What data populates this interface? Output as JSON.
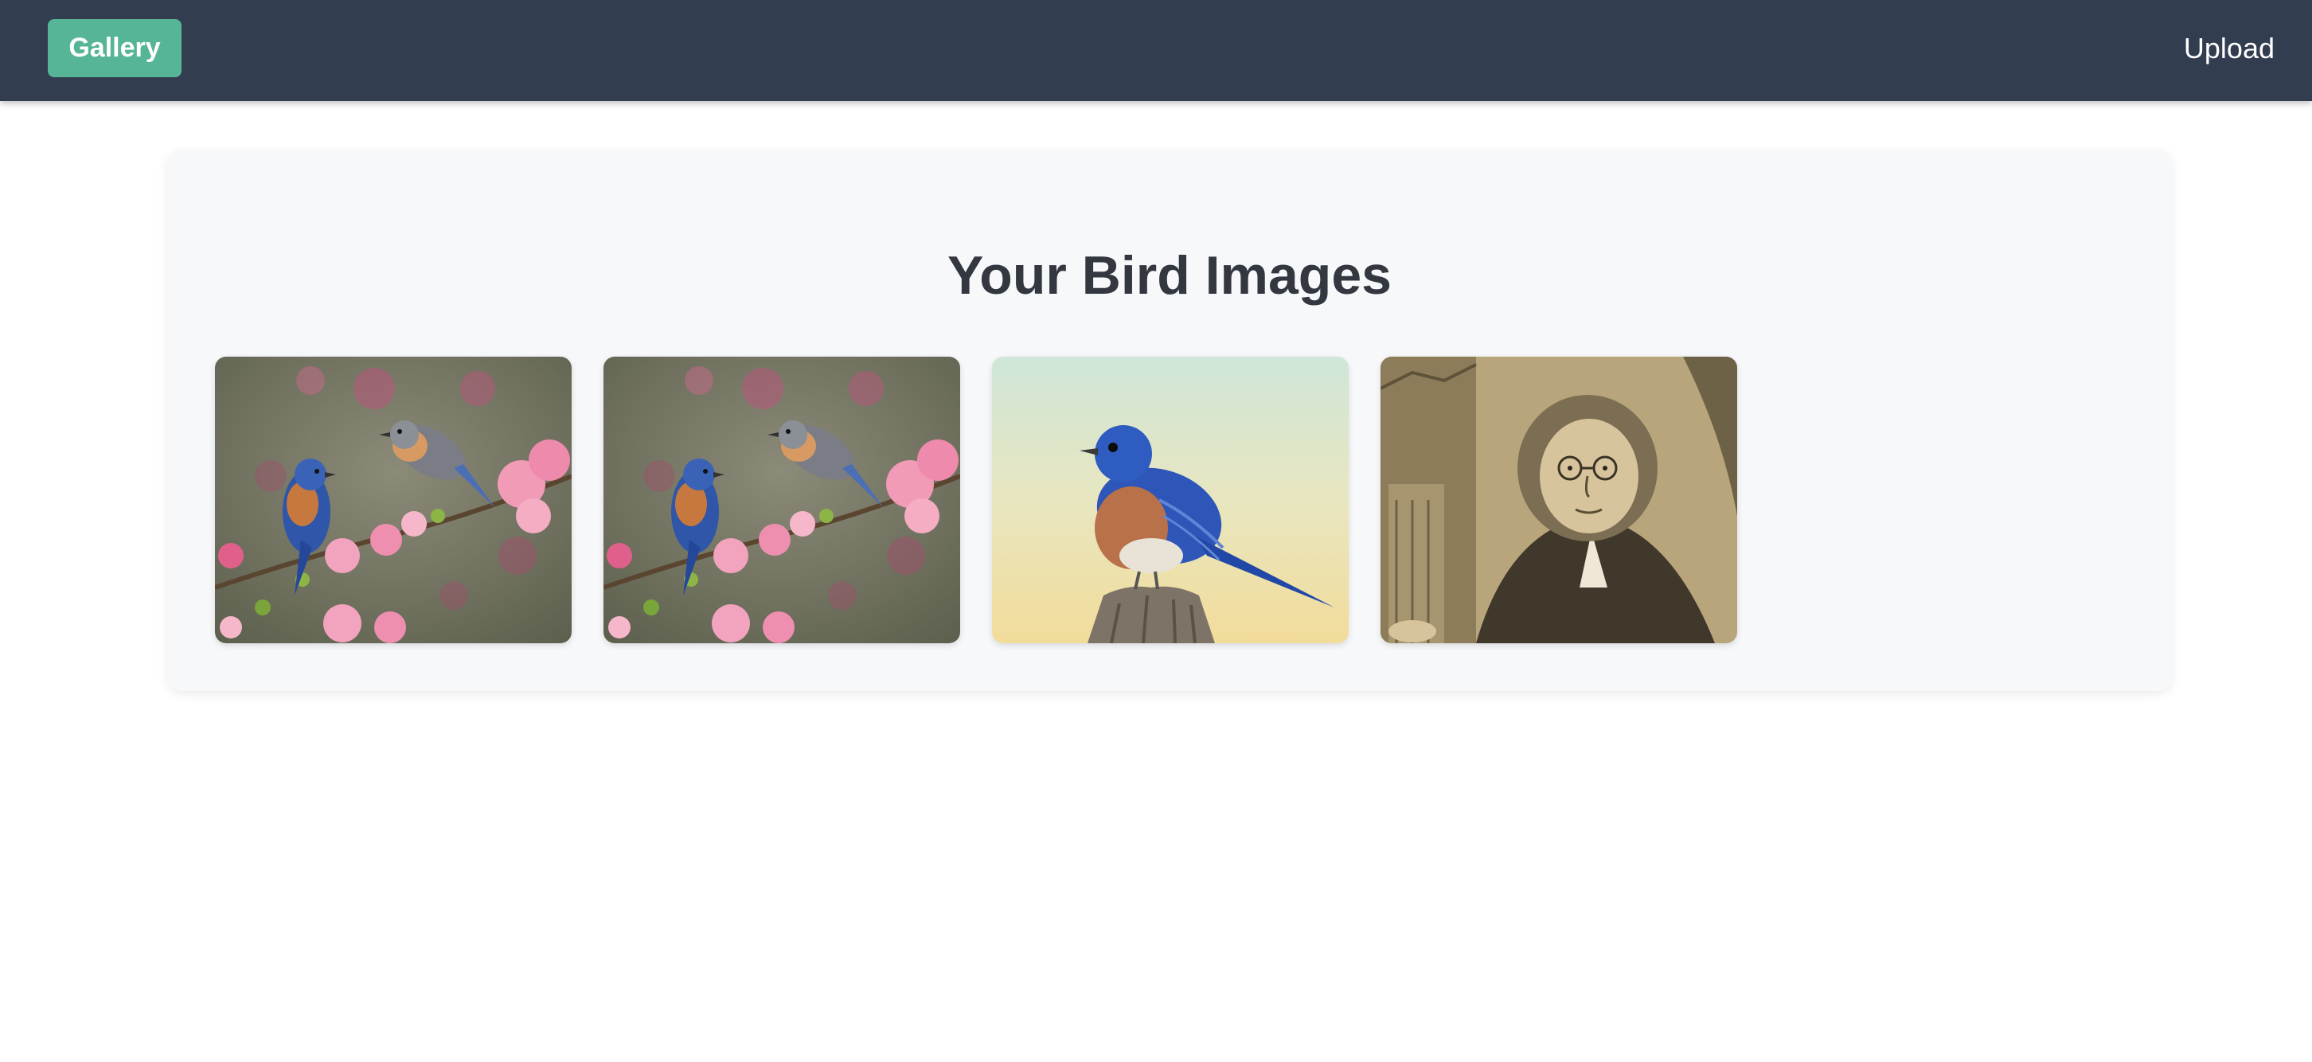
{
  "navbar": {
    "brand_label": "Gallery",
    "upload_label": "Upload",
    "background_color": "#323d4f",
    "brand_color": "#55b596"
  },
  "main": {
    "title": "Your Bird Images",
    "images": [
      {
        "subject": "two bluebirds on a blossoming branch"
      },
      {
        "subject": "two bluebirds on a blossoming branch"
      },
      {
        "subject": "bluebird perched on a stump"
      },
      {
        "subject": "engraved portrait of a man"
      }
    ]
  }
}
